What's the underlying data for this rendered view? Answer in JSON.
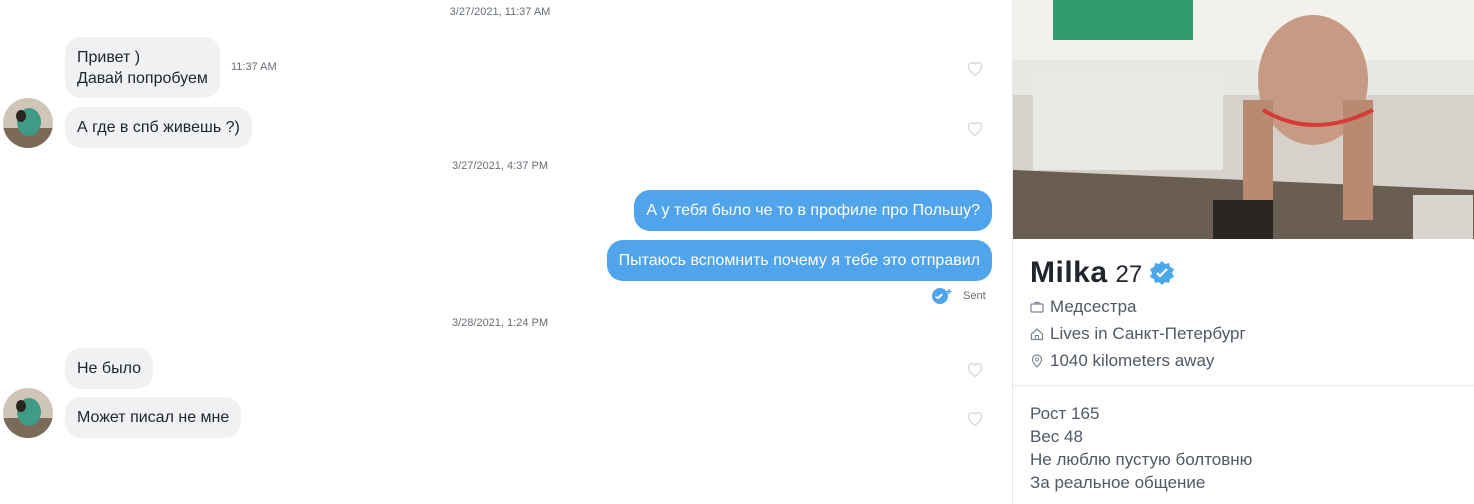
{
  "chat": {
    "groups": [
      {
        "timestamp": "3/27/2021, 11:37 AM",
        "messages": [
          {
            "lines": [
              "Привет )",
              "Давай попробуем"
            ],
            "time": "11:37 AM"
          },
          {
            "lines": [
              "А где в спб живешь ?)"
            ]
          }
        ]
      },
      {
        "timestamp": "3/27/2021, 4:37 PM",
        "messages": [
          {
            "lines": [
              "А у тебя было че то в профиле про Польшу?"
            ]
          },
          {
            "lines": [
              "Пытаюсь вспомнить почему я тебе это отправил"
            ],
            "status": "Sent"
          }
        ]
      },
      {
        "timestamp": "3/28/2021, 1:24 PM",
        "messages": [
          {
            "lines": [
              "Не было"
            ]
          },
          {
            "lines": [
              "Может писал не мне"
            ]
          }
        ]
      }
    ]
  },
  "profile": {
    "name": "Milka",
    "age": "27",
    "job": "Медсестра",
    "lives_prefix": "Lives in ",
    "city": "Санкт-Петербург",
    "distance": "1040 kilometers away",
    "bio": [
      "Рост 165",
      "Вес 48",
      "Не люблю пустую болтовню",
      "За реальное общение"
    ]
  },
  "colors": {
    "accent": "#4fa4ec",
    "incoming_bubble": "#eff1f3",
    "verified": "#4aa7e8"
  },
  "icons": {
    "heart": "heart-outline-icon",
    "sent": "double-check-icon",
    "job": "briefcase-icon",
    "lives": "home-icon",
    "distance": "location-pin-icon",
    "verified": "verified-badge-icon"
  }
}
